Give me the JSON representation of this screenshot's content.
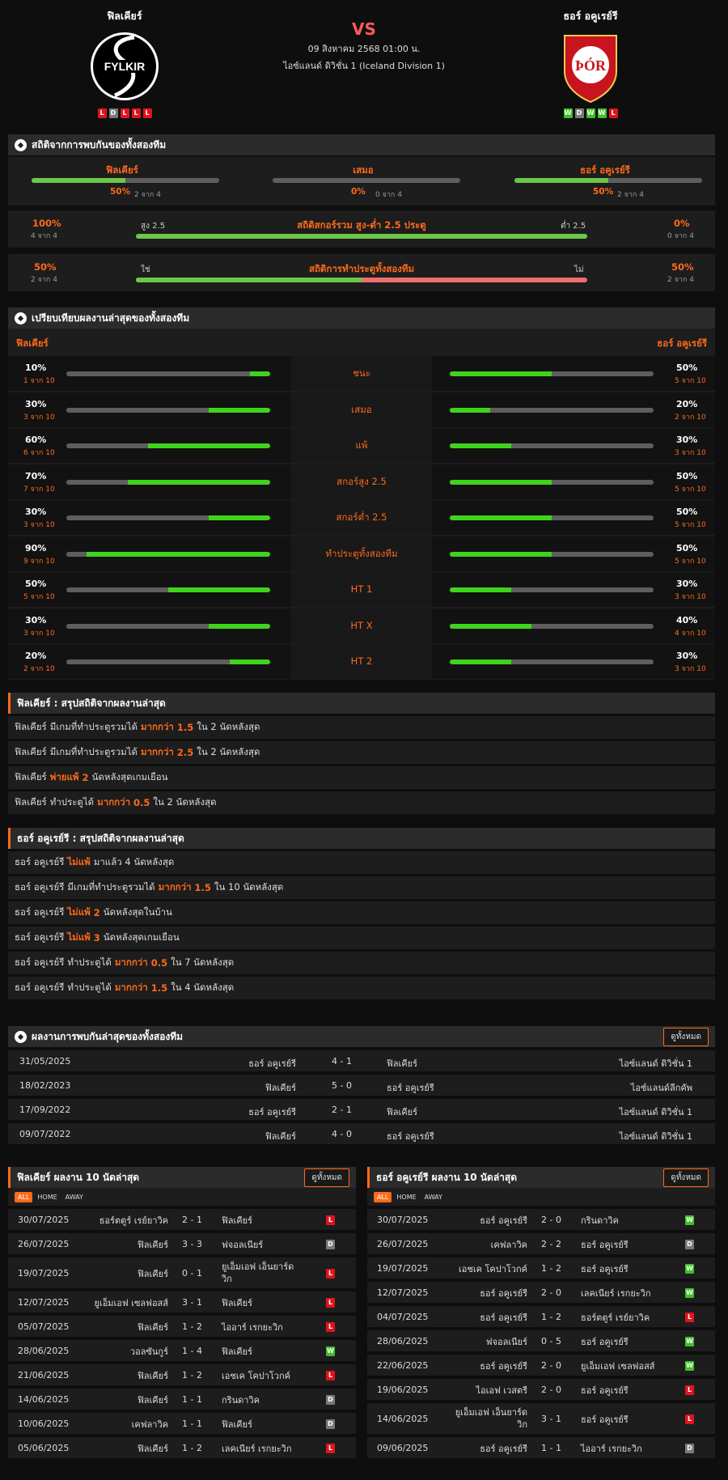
{
  "header": {
    "home": {
      "name": "ฟิลเคียร์",
      "logo_text": "FYLKIR",
      "form": [
        "L",
        "D",
        "L",
        "L",
        "L"
      ]
    },
    "away": {
      "name": "ธอร์ อคูเรย์รี",
      "logo_text": "ÞÓR",
      "form": [
        "W",
        "D",
        "W",
        "W",
        "L"
      ]
    },
    "vs": "VS",
    "date": "09 สิงหาคม 2568 01:00 น.",
    "league": "ไอซ์แลนด์ ดิวิชั่น 1 (Iceland Division 1)"
  },
  "h2h_stats": {
    "title": "สถิติจากการพบกันของทั้งสองทีม",
    "cols": [
      {
        "label": "ฟิลเคียร์",
        "pct": "50%",
        "of": "2 จาก 4",
        "value": 0.5
      },
      {
        "label": "เสมอ",
        "pct": "0%",
        "of": "0 จาก 4",
        "value": 0
      },
      {
        "label": "ธอร์ อคูเรย์รี",
        "pct": "50%",
        "of": "2 จาก 4",
        "value": 0.5
      }
    ],
    "goals": {
      "title": "สถิติสกอร์รวม สูง-ต่ำ 2.5 ประตู",
      "left_pct": "100%",
      "left_of": "4 จาก 4",
      "right_pct": "0%",
      "right_of": "0 จาก 4",
      "left_label": "สูง 2.5",
      "right_label": "ต่ำ 2.5",
      "value": 1.0
    },
    "btts": {
      "title": "สถิติการทำประตูทั้งสองทีม",
      "left_pct": "50%",
      "left_of": "2 จาก 4",
      "right_pct": "50%",
      "right_of": "2 จาก 4",
      "left_label": "ใช่",
      "right_label": "ไม่",
      "value": 0.5
    }
  },
  "compare": {
    "title": "เปรียบเทียบผลงานล่าสุดของทั้งสองทีม",
    "home_label": "ฟิลเคียร์",
    "away_label": "ธอร์ อคูเรย์รี",
    "rows": [
      {
        "label": "ชนะ",
        "hp": "10%",
        "ho": "1 จาก 10",
        "hv": 0.1,
        "ap": "50%",
        "ao": "5 จาก 10",
        "av": 0.5
      },
      {
        "label": "เสมอ",
        "hp": "30%",
        "ho": "3 จาก 10",
        "hv": 0.3,
        "ap": "20%",
        "ao": "2 จาก 10",
        "av": 0.2
      },
      {
        "label": "แพ้",
        "hp": "60%",
        "ho": "6 จาก 10",
        "hv": 0.6,
        "ap": "30%",
        "ao": "3 จาก 10",
        "av": 0.3
      },
      {
        "label": "สกอร์สูง 2.5",
        "hp": "70%",
        "ho": "7 จาก 10",
        "hv": 0.7,
        "ap": "50%",
        "ao": "5 จาก 10",
        "av": 0.5
      },
      {
        "label": "สกอร์ต่ำ 2.5",
        "hp": "30%",
        "ho": "3 จาก 10",
        "hv": 0.3,
        "ap": "50%",
        "ao": "5 จาก 10",
        "av": 0.5
      },
      {
        "label": "ทำประตูทั้งสองทีม",
        "hp": "90%",
        "ho": "9 จาก 10",
        "hv": 0.9,
        "ap": "50%",
        "ao": "5 จาก 10",
        "av": 0.5
      },
      {
        "label": "HT 1",
        "hp": "50%",
        "ho": "5 จาก 10",
        "hv": 0.5,
        "ap": "30%",
        "ao": "3 จาก 10",
        "av": 0.3
      },
      {
        "label": "HT X",
        "hp": "30%",
        "ho": "3 จาก 10",
        "hv": 0.3,
        "ap": "40%",
        "ao": "4 จาก 10",
        "av": 0.4
      },
      {
        "label": "HT 2",
        "hp": "20%",
        "ho": "2 จาก 10",
        "hv": 0.2,
        "ap": "30%",
        "ao": "3 จาก 10",
        "av": 0.3
      }
    ]
  },
  "summary_home": {
    "title": "ฟิลเคียร์ : สรุปสถิติจากผลงานล่าสุด",
    "rows": [
      [
        "ฟิลเคียร์",
        "มีเกมที่ทำประตูรวมได้",
        "มากกว่า",
        "1.5",
        "ใน 2 นัดหลังสุด"
      ],
      [
        "ฟิลเคียร์",
        "มีเกมที่ทำประตูรวมได้",
        "มากกว่า",
        "2.5",
        "ใน 2 นัดหลังสุด"
      ],
      [
        "ฟิลเคียร์",
        "",
        "พ่ายแพ้",
        "2",
        "นัดหลังสุดเกมเยือน"
      ],
      [
        "ฟิลเคียร์",
        "ทำประตูได้",
        "มากกว่า",
        "0.5",
        "ใน 2 นัดหลังสุด"
      ]
    ]
  },
  "summary_away": {
    "title": "ธอร์ อคูเรย์รี : สรุปสถิติจากผลงานล่าสุด",
    "rows": [
      [
        "ธอร์ อคูเรย์รี",
        "",
        "ไม่แพ้",
        "",
        "มาแล้ว 4 นัดหลังสุด"
      ],
      [
        "ธอร์ อคูเรย์รี",
        "มีเกมที่ทำประตูรวมได้",
        "มากกว่า",
        "1.5",
        "ใน 10 นัดหลังสุด"
      ],
      [
        "ธอร์ อคูเรย์รี",
        "",
        "ไม่แพ้",
        "2",
        "นัดหลังสุดในบ้าน"
      ],
      [
        "ธอร์ อคูเรย์รี",
        "",
        "ไม่แพ้",
        "3",
        "นัดหลังสุดเกมเยือน"
      ],
      [
        "ธอร์ อคูเรย์รี",
        "ทำประตูได้",
        "มากกว่า",
        "0.5",
        "ใน 7 นัดหลังสุด"
      ],
      [
        "ธอร์ อคูเรย์รี",
        "ทำประตูได้",
        "มากกว่า",
        "1.5",
        "ใน 4 นัดหลังสุด"
      ]
    ]
  },
  "h2h_matches": {
    "title": "ผลงานการพบกันล่าสุดของทั้งสองทีม",
    "button": "ดูทั้งหมด",
    "rows": [
      {
        "date": "31/05/2025",
        "home": "ธอร์ อคูเรย์รี",
        "score": "4 - 1",
        "away": "ฟิลเคียร์",
        "league": "ไอซ์แลนด์ ดิวิชั่น 1"
      },
      {
        "date": "18/02/2023",
        "home": "ฟิลเคียร์",
        "score": "5 - 0",
        "away": "ธอร์ อคูเรย์รี",
        "league": "ไอซ์แลนด์ลีกคัพ"
      },
      {
        "date": "17/09/2022",
        "home": "ธอร์ อคูเรย์รี",
        "score": "2 - 1",
        "away": "ฟิลเคียร์",
        "league": "ไอซ์แลนด์ ดิวิชั่น 1"
      },
      {
        "date": "09/07/2022",
        "home": "ฟิลเคียร์",
        "score": "4 - 0",
        "away": "ธอร์ อคูเรย์รี",
        "league": "ไอซ์แลนด์ ดิวิชั่น 1"
      }
    ]
  },
  "last10_home": {
    "title": "ฟิลเคียร์ ผลงาน 10 นัดล่าสุด",
    "button": "ดูทั้งหมด",
    "filters": [
      "ALL",
      "HOME",
      "AWAY"
    ],
    "rows": [
      {
        "date": "30/07/2025",
        "home": "ธอร์ตตูร์ เรย์ยาวิค",
        "score": "2 - 1",
        "away": "ฟิลเคียร์",
        "r": "L"
      },
      {
        "date": "26/07/2025",
        "home": "ฟิลเคียร์",
        "score": "3 - 3",
        "away": "ฟจอลเนียร์",
        "r": "D"
      },
      {
        "date": "19/07/2025",
        "home": "ฟิลเคียร์",
        "score": "0 - 1",
        "away": "ยูเอ็มเอฟ เอ็นยาร์ดวิก",
        "r": "L"
      },
      {
        "date": "12/07/2025",
        "home": "ยูเอ็มเอฟ เซลฟอสส์",
        "score": "3 - 1",
        "away": "ฟิลเคียร์",
        "r": "L"
      },
      {
        "date": "05/07/2025",
        "home": "ฟิลเคียร์",
        "score": "1 - 2",
        "away": "ไออาร์ เรกยะวิก",
        "r": "L"
      },
      {
        "date": "28/06/2025",
        "home": "วอลซันกูร์",
        "score": "1 - 4",
        "away": "ฟิลเคียร์",
        "r": "W"
      },
      {
        "date": "21/06/2025",
        "home": "ฟิลเคียร์",
        "score": "1 - 2",
        "away": "เอชเค โคปาโวกค์",
        "r": "L"
      },
      {
        "date": "14/06/2025",
        "home": "ฟิลเคียร์",
        "score": "1 - 1",
        "away": "กรินดาวิค",
        "r": "D"
      },
      {
        "date": "10/06/2025",
        "home": "เคฟลาวิค",
        "score": "1 - 1",
        "away": "ฟิลเคียร์",
        "r": "D"
      },
      {
        "date": "05/06/2025",
        "home": "ฟิลเคียร์",
        "score": "1 - 2",
        "away": "เลคเนียร์ เรกยะวิก",
        "r": "L"
      }
    ]
  },
  "last10_away": {
    "title": "ธอร์ อคูเรย์รี ผลงาน 10 นัดล่าสุด",
    "button": "ดูทั้งหมด",
    "filters": [
      "ALL",
      "HOME",
      "AWAY"
    ],
    "rows": [
      {
        "date": "30/07/2025",
        "home": "ธอร์ อคูเรย์รี",
        "score": "2 - 0",
        "away": "กรินดาวิค",
        "r": "W"
      },
      {
        "date": "26/07/2025",
        "home": "เคฟลาวิค",
        "score": "2 - 2",
        "away": "ธอร์ อคูเรย์รี",
        "r": "D"
      },
      {
        "date": "19/07/2025",
        "home": "เอชเค โคปาโวกค์",
        "score": "1 - 2",
        "away": "ธอร์ อคูเรย์รี",
        "r": "W"
      },
      {
        "date": "12/07/2025",
        "home": "ธอร์ อคูเรย์รี",
        "score": "2 - 0",
        "away": "เลคเนียร์ เรกยะวิก",
        "r": "W"
      },
      {
        "date": "04/07/2025",
        "home": "ธอร์ อคูเรย์รี",
        "score": "1 - 2",
        "away": "ธอร์ตตูร์ เรย์ยาวิค",
        "r": "L"
      },
      {
        "date": "28/06/2025",
        "home": "ฟจอลเนียร์",
        "score": "0 - 5",
        "away": "ธอร์ อคูเรย์รี",
        "r": "W"
      },
      {
        "date": "22/06/2025",
        "home": "ธอร์ อคูเรย์รี",
        "score": "2 - 0",
        "away": "ยูเอ็มเอฟ เซลฟอสส์",
        "r": "W"
      },
      {
        "date": "19/06/2025",
        "home": "ไอเอฟ เวสตรี",
        "score": "2 - 0",
        "away": "ธอร์ อคูเรย์รี",
        "r": "L"
      },
      {
        "date": "14/06/2025",
        "home": "ยูเอ็มเอฟ เอ็นยาร์ดวิก",
        "score": "3 - 1",
        "away": "ธอร์ อคูเรย์รี",
        "r": "L"
      },
      {
        "date": "09/06/2025",
        "home": "ธอร์ อคูเรย์รี",
        "score": "1 - 1",
        "away": "ไออาร์ เรกยะวิก",
        "r": "D"
      }
    ]
  },
  "colors": {
    "accent": "#ff6a1a",
    "win": "#3fbf2a",
    "draw": "#7a7a7a",
    "loss": "#e0141e",
    "bar": "#6cc64a",
    "bar_red": "#ef6e6e"
  }
}
